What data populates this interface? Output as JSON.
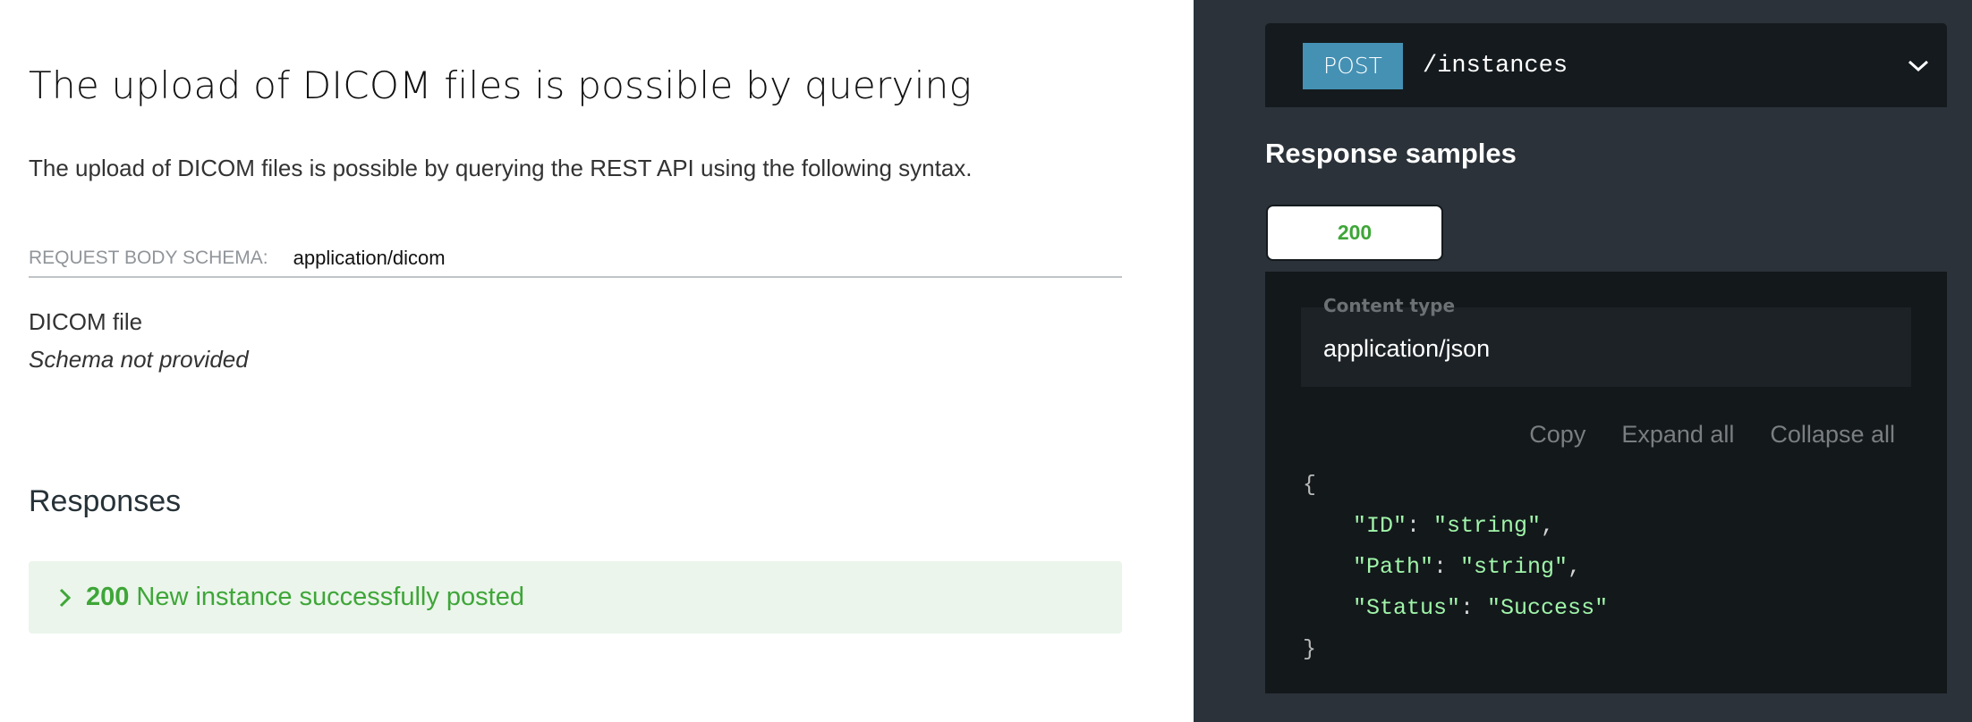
{
  "operation": {
    "title": "The upload of DICOM files is possible by querying",
    "description": "The upload of DICOM files is possible by querying the REST API using the following syntax.",
    "request_body": {
      "schema_label": "Request Body schema:",
      "content_type": "application/dicom",
      "name": "DICOM file",
      "note": "Schema not provided"
    },
    "responses": {
      "title": "Responses",
      "items": [
        {
          "code": "200",
          "description": "New instance successfully posted",
          "icon": "chevron-right-icon",
          "color": "#3ea638"
        }
      ]
    }
  },
  "endpoint": {
    "method": "POST",
    "path": "/instances",
    "method_color": "#4591b4",
    "toggle_icon": "chevron-down-icon"
  },
  "response_samples": {
    "title": "Response samples",
    "tabs": [
      {
        "label": "200",
        "selected": true,
        "color": "#3ea638"
      }
    ],
    "content_type_label": "Content type",
    "content_type_value": "application/json",
    "actions": {
      "copy": "Copy",
      "expand_all": "Expand all",
      "collapse_all": "Collapse all"
    },
    "json": {
      "open": "{",
      "close": "}",
      "fields": [
        {
          "key": "\"ID\"",
          "value": "\"string\"",
          "comma": ","
        },
        {
          "key": "\"Path\"",
          "value": "\"string\"",
          "comma": ","
        },
        {
          "key": "\"Status\"",
          "value": "\"Success\"",
          "comma": ""
        }
      ]
    }
  }
}
